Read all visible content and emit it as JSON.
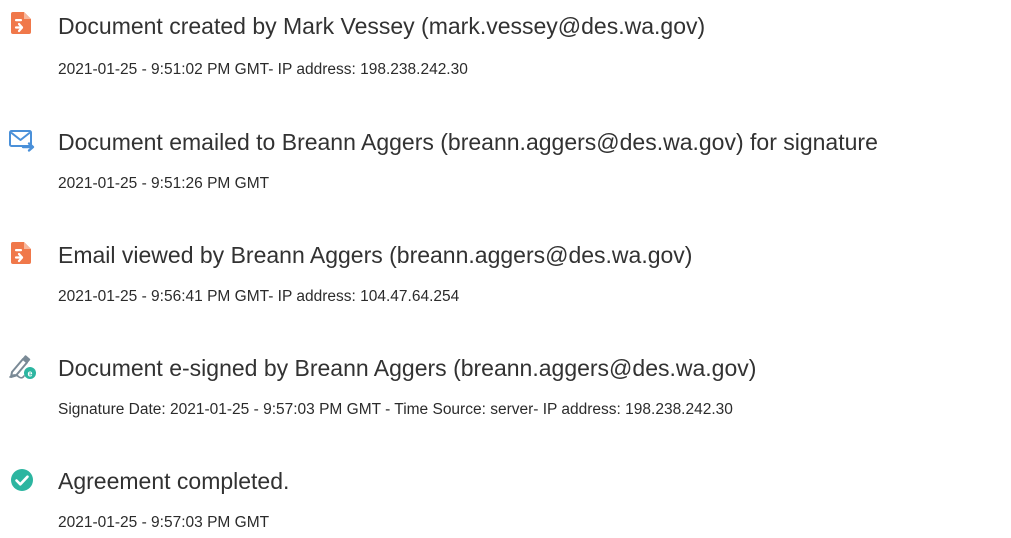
{
  "events": [
    {
      "icon": "document-created-icon",
      "title": "Document created by Mark Vessey (mark.vessey@des.wa.gov)",
      "detail": "2021-01-25 - 9:51:02 PM GMT- IP address: 198.238.242.30"
    },
    {
      "icon": "document-emailed-icon",
      "title": "Document emailed to Breann Aggers (breann.aggers@des.wa.gov) for signature",
      "detail": "2021-01-25 - 9:51:26 PM GMT"
    },
    {
      "icon": "email-viewed-icon",
      "title": "Email viewed by Breann Aggers (breann.aggers@des.wa.gov)",
      "detail": "2021-01-25 - 9:56:41 PM GMT- IP address: 104.47.64.254"
    },
    {
      "icon": "e-signed-icon",
      "title": "Document e-signed by Breann Aggers (breann.aggers@des.wa.gov)",
      "detail": "Signature Date: 2021-01-25 - 9:57:03 PM GMT - Time Source: server- IP address: 198.238.242.30"
    },
    {
      "icon": "agreement-completed-icon",
      "title": "Agreement completed.",
      "detail": "2021-01-25 - 9:57:03 PM GMT"
    }
  ],
  "colors": {
    "document_icon": "#f0784a",
    "email_icon": "#4a90d9",
    "completed_icon": "#2cb5a0",
    "esign_accent": "#2cb5a0"
  }
}
